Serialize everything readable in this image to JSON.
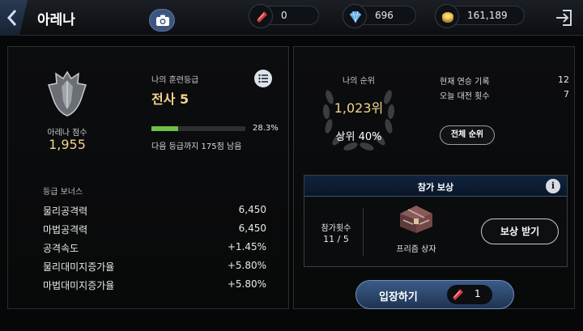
{
  "header": {
    "title": "아레나",
    "currencies": [
      {
        "icon": "red-ticket-icon",
        "value": "0"
      },
      {
        "icon": "diamond-icon",
        "value": "696"
      },
      {
        "icon": "gold-coin-icon",
        "value": "161,189"
      }
    ]
  },
  "left_panel": {
    "score_label": "아레나 점수",
    "score_value": "1,955",
    "grade_label": "나의 훈련등급",
    "grade_value": "전사 5",
    "progress_fraction": 0.283,
    "progress_text": "28.3%",
    "progress_note": "다음 등급까지 175점 남음",
    "bonus_title": "등급 보너스",
    "bonuses": [
      {
        "name": "물리공격력",
        "value": "6,450"
      },
      {
        "name": "마법공격력",
        "value": "6,450"
      },
      {
        "name": "공격속도",
        "value": "+1.45%"
      },
      {
        "name": "물리대미지증가율",
        "value": "+5.80%"
      },
      {
        "name": "마법대미지증가율",
        "value": "+5.80%"
      }
    ]
  },
  "right_panel": {
    "my_rank_label": "나의 순위",
    "my_rank_value": "1,023위",
    "my_rank_top": "상위 40%",
    "stats": [
      {
        "label": "현재 연승 기록",
        "value": "12"
      },
      {
        "label": "오늘 대전 횟수",
        "value": "7"
      }
    ],
    "full_rank_button": "전체 순위",
    "reward": {
      "title": "참가 보상",
      "info_label": "i",
      "entries_label": "참가횟수",
      "entries_value": "11 / 5",
      "item_name": "프리즘 상자",
      "claim_button": "보상 받기"
    },
    "enter_button": "입장하기",
    "enter_cost": "1"
  },
  "colors": {
    "gold_text": "#f3d48a",
    "progress_green": "#6fbf4a",
    "button_blue": "#3b5b86"
  }
}
